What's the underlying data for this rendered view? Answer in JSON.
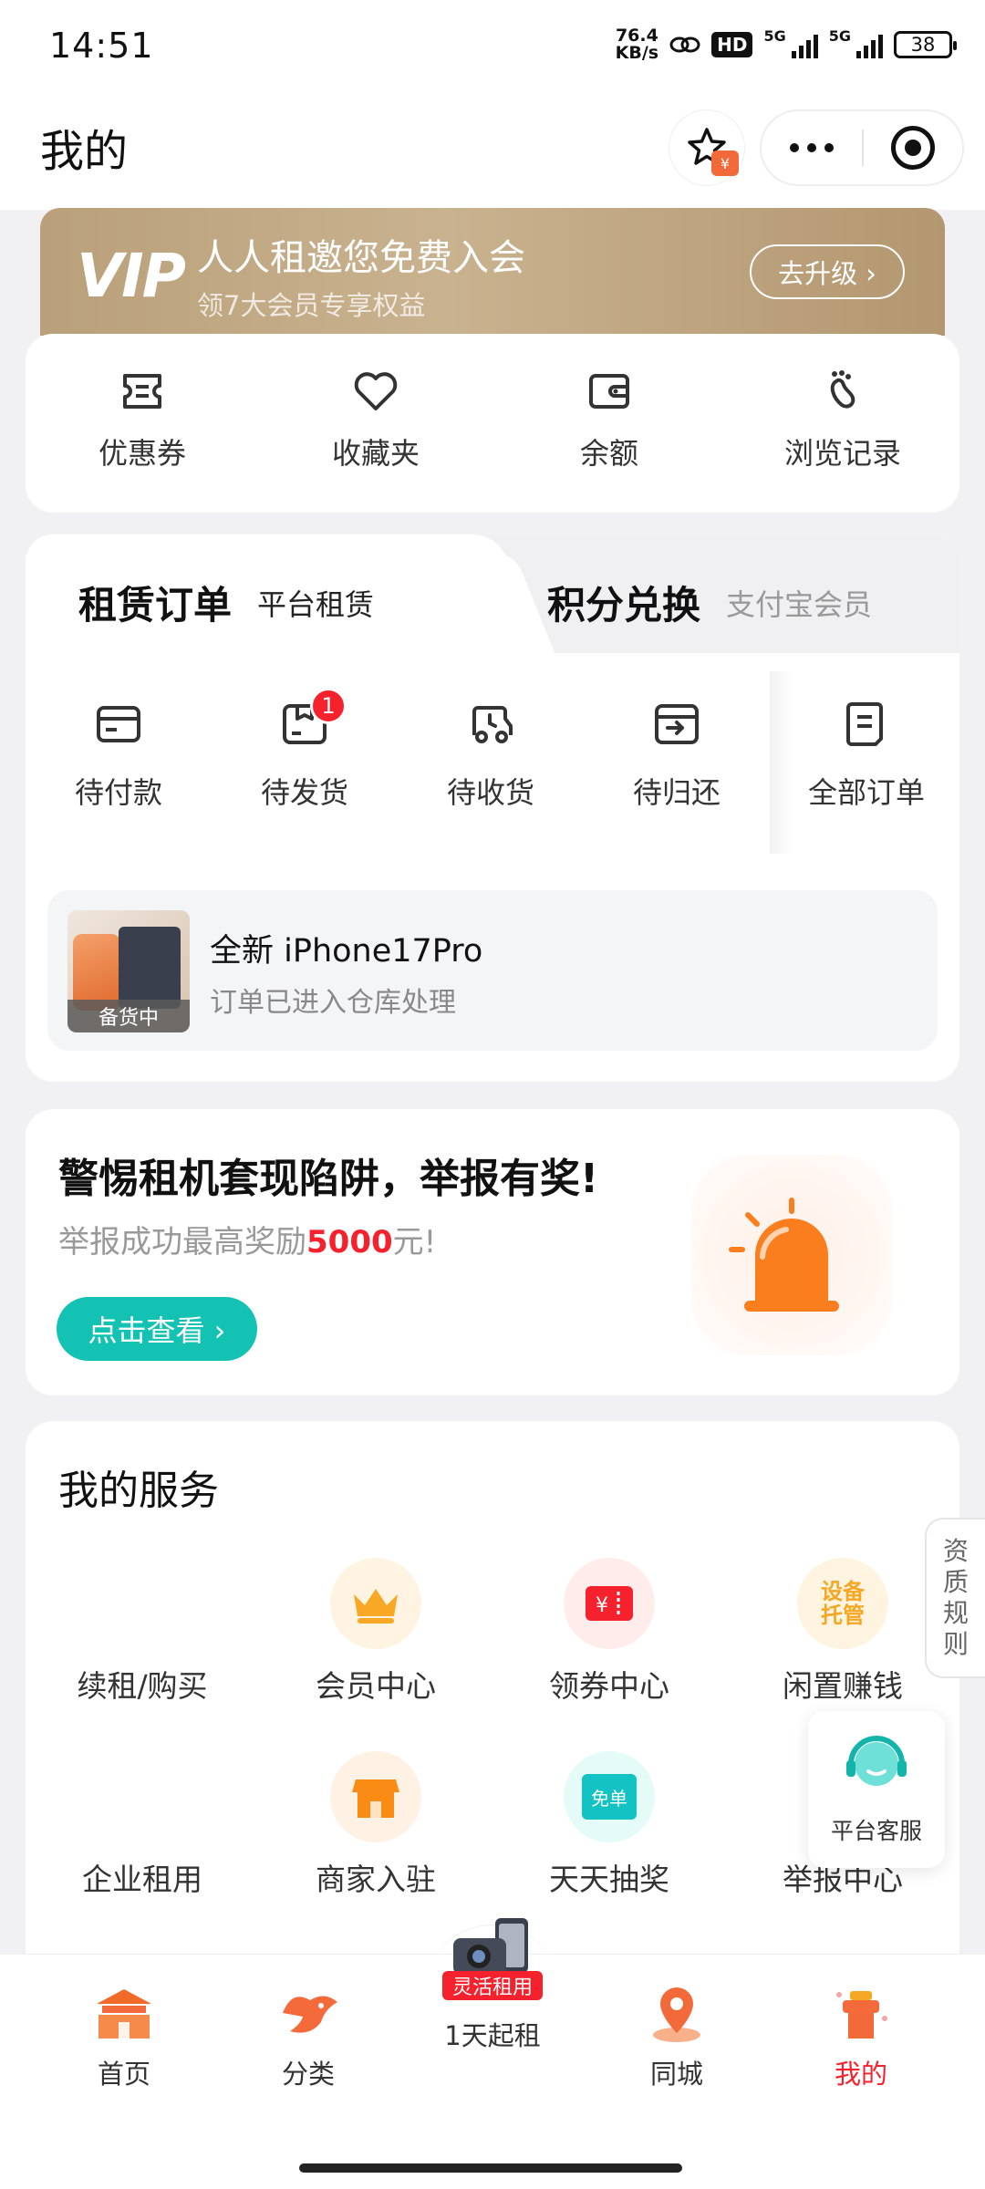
{
  "status": {
    "time": "14:51",
    "speed_value": "76.4",
    "speed_unit": "KB/s",
    "hd": "HD",
    "net1": "5G",
    "net2": "5G",
    "battery": "38"
  },
  "header": {
    "title": "我的"
  },
  "vip": {
    "logo": "VIP",
    "title": "人人租邀您免费入会",
    "subtitle": "领7大会员专享权益",
    "button": "去升级 ›"
  },
  "quick": {
    "items": [
      {
        "label": "优惠券",
        "icon": "coupon-icon"
      },
      {
        "label": "收藏夹",
        "icon": "heart-icon"
      },
      {
        "label": "余额",
        "icon": "wallet-icon"
      },
      {
        "label": "浏览记录",
        "icon": "footprint-icon"
      }
    ]
  },
  "orders": {
    "tab_active": {
      "title": "租赁订单",
      "subtitle": "平台租赁"
    },
    "tab_inactive": {
      "title": "积分兑换",
      "subtitle": "支付宝会员"
    },
    "items": [
      {
        "label": "待付款",
        "icon": "card-icon"
      },
      {
        "label": "待发货",
        "icon": "box-icon",
        "badge": "1"
      },
      {
        "label": "待收货",
        "icon": "truck-icon"
      },
      {
        "label": "待归还",
        "icon": "return-icon"
      },
      {
        "label": "全部订单",
        "icon": "list-icon"
      }
    ],
    "notice": {
      "title": "全新 iPhone17Pro",
      "subtitle": "订单已进入仓库处理",
      "tag": "备货中"
    }
  },
  "report": {
    "title": "警惕租机套现陷阱，举报有奖!",
    "sub_prefix": "举报成功最高奖励",
    "amount": "5000",
    "sub_suffix": "元!",
    "button": "点击查看 ›"
  },
  "services": {
    "title": "我的服务",
    "items": [
      {
        "label": "续租/购买"
      },
      {
        "label": "会员中心",
        "icon": "crown-icon",
        "color": "#f9a825"
      },
      {
        "label": "领券中心",
        "icon": "ticket-icon",
        "color": "#f5222d"
      },
      {
        "label": "闲置赚钱",
        "icon": "idle-icon",
        "color": "#f5a623",
        "icon_text": "设备托管"
      },
      {
        "label": "企业租用"
      },
      {
        "label": "商家入驻",
        "icon": "store-icon",
        "color": "#fa8c16"
      },
      {
        "label": "天天抽奖",
        "icon": "free-order-icon",
        "color": "#13c2c2",
        "icon_text": "免单"
      },
      {
        "label": "举报中心"
      }
    ]
  },
  "side_tab": {
    "label": "资质规则"
  },
  "cs": {
    "label": "平台客服"
  },
  "tabbar": {
    "items": [
      {
        "label": "首页",
        "icon": "home-icon"
      },
      {
        "label": "分类",
        "icon": "bird-icon"
      },
      {
        "label": "1天起租",
        "icon": "camera-icon",
        "badge": "灵活租用"
      },
      {
        "label": "同城",
        "icon": "location-icon"
      },
      {
        "label": "我的",
        "icon": "profile-icon",
        "active": true
      }
    ]
  },
  "colors": {
    "accent": "#f5222d",
    "teal": "#14c2b4",
    "vip_gold": "#c3aa84"
  }
}
